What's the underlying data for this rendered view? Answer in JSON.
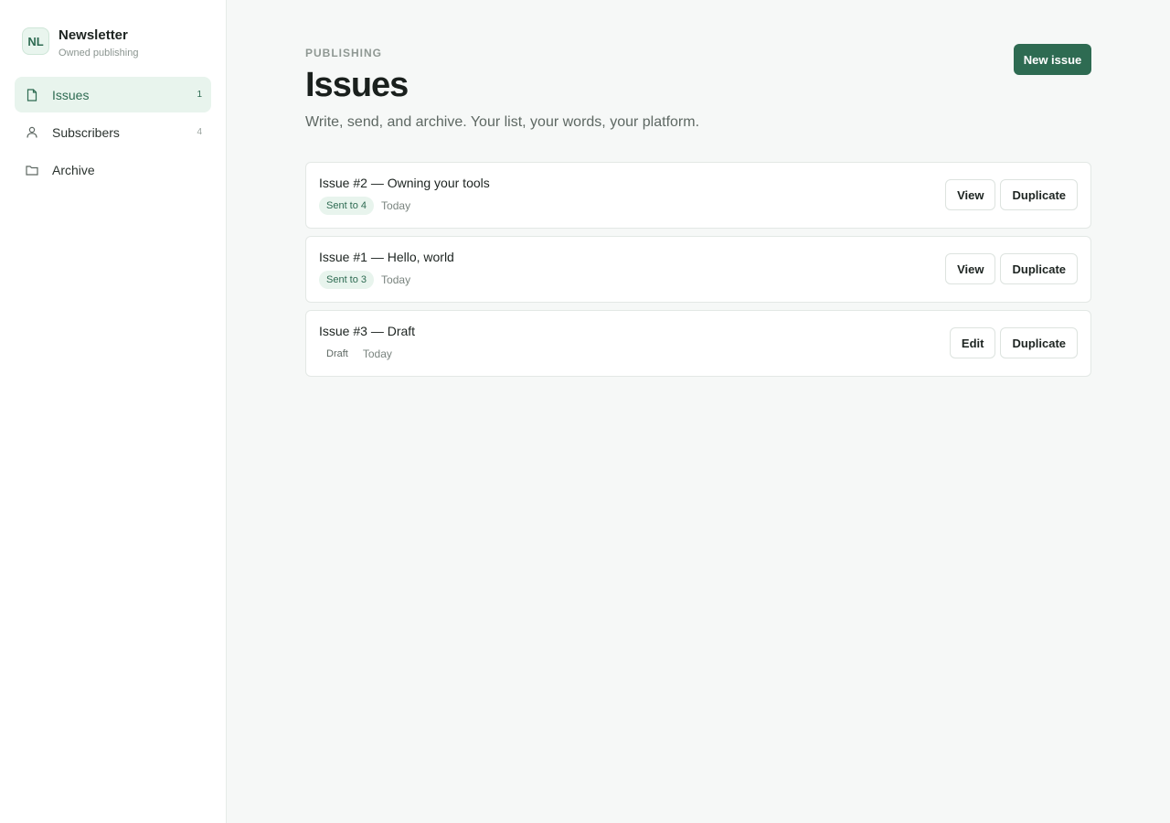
{
  "brand": {
    "logo": "NL",
    "name": "Newsletter",
    "subtitle": "Owned publishing"
  },
  "sidebar": {
    "items": [
      {
        "label": "Issues",
        "count": "1",
        "icon": "document-icon",
        "active": true
      },
      {
        "label": "Subscribers",
        "count": "4",
        "icon": "person-icon",
        "active": false
      },
      {
        "label": "Archive",
        "count": "",
        "icon": "folder-icon",
        "active": false
      }
    ]
  },
  "header": {
    "eyebrow": "PUBLISHING",
    "title": "Issues",
    "subtitle": "Write, send, and archive. Your list, your words, your platform.",
    "new_button": "New issue"
  },
  "issues": [
    {
      "title": "Issue #2 — Owning your tools",
      "badge": "Sent to 4",
      "date": "Today",
      "primary_action": "View",
      "secondary_action": "Duplicate"
    },
    {
      "title": "Issue #1 — Hello, world",
      "badge": "Sent to 3",
      "date": "Today",
      "primary_action": "View",
      "secondary_action": "Duplicate"
    },
    {
      "title": "Issue #3 — Draft",
      "badge": "Draft",
      "date": "Today",
      "primary_action": "Edit",
      "secondary_action": "Duplicate"
    }
  ],
  "colors": {
    "accent": "#2e6b52",
    "accent_soft": "#e8f4ed",
    "background": "#f6f8f7"
  }
}
